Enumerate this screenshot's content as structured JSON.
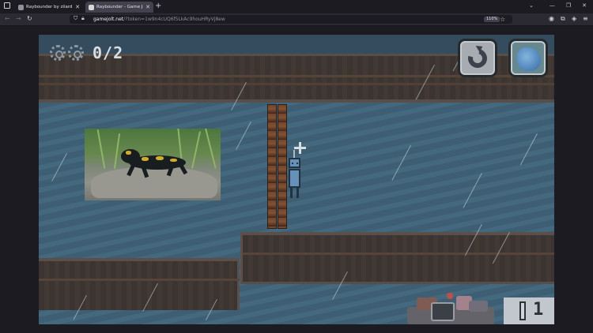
{
  "browser": {
    "tabs": [
      {
        "title": "Raybounder by zilard - Play Onl",
        "active": false
      },
      {
        "title": "Raybounder - Game Jolt",
        "active": true
      }
    ],
    "url_host": "gamejolt.net",
    "url_path": "/?token=1w9n4cUQ6f5LkAc9houHRyVj8ew",
    "zoom": "110%"
  },
  "game": {
    "collected": "0/2",
    "lives": "1",
    "icons": {
      "collectible": "gear-icon",
      "restart": "restart-icon",
      "character": "character-portrait-icon"
    },
    "colors": {
      "water": "#3e5f73",
      "dirt": "#3a2c25",
      "hud_text": "#f4f4f4"
    }
  }
}
